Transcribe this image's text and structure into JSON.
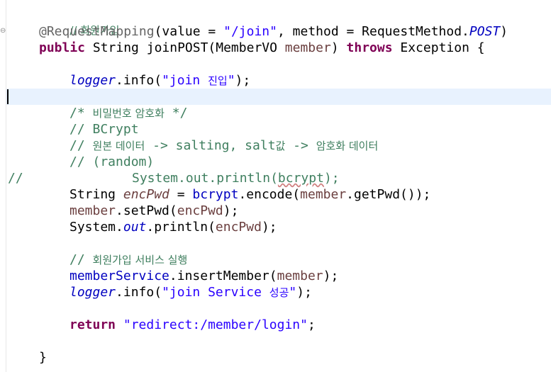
{
  "editor": {
    "fold_marker": "⊖",
    "lines": {
      "l1": {
        "comment": "// 회원가입"
      },
      "l2": {
        "annotation": "@RequestMapping",
        "p1": "(value = ",
        "str": "\"/join\"",
        "p2": ", method = RequestMethod.",
        "const": "POST",
        "p3": ")"
      },
      "l3": {
        "kw1": "public",
        "p1": " String joinPOST(MemberVO ",
        "param": "member",
        "p2": ") ",
        "kw2": "throws",
        "p3": " Exception {"
      },
      "l4": {
        "field": "logger",
        "p1": ".info(",
        "str_a": "\"join ",
        "str_b": "진입",
        "str_c": "\"",
        "p2": ");"
      },
      "l5": {
        "comment_a": "/* ",
        "comment_b": "비밀번호 암호화",
        "comment_c": " */"
      },
      "l6": {
        "comment": "// BCrypt"
      },
      "l7": {
        "comment_a": "// ",
        "comment_b": "원본 데이터",
        "comment_c": " -> salting, salt",
        "comment_d": "값",
        "comment_e": " -> ",
        "comment_f": "암호화 데이터"
      },
      "l8": {
        "comment": "// (random)"
      },
      "l9": {
        "prefix": "//",
        "code_a": "System.out.println(",
        "code_b": "bcrypt",
        "code_c": ");"
      },
      "l10": {
        "p1": "String ",
        "local": "encPwd",
        "p2": " = ",
        "field": "bcrypt",
        "p3": ".encode(",
        "param": "member",
        "p4": ".getPwd());"
      },
      "l11": {
        "param": "member",
        "p1": ".setPwd(",
        "local": "encPwd",
        "p2": ");"
      },
      "l12": {
        "p1": "System.",
        "static": "out",
        "p2": ".println(",
        "local": "encPwd",
        "p3": ");"
      },
      "l13": {
        "comment_a": "// ",
        "comment_b": "회원가입 서비스 실행"
      },
      "l14": {
        "field": "memberService",
        "p1": ".insertMember(",
        "param": "member",
        "p2": ");"
      },
      "l15": {
        "field": "logger",
        "p1": ".info(",
        "str_a": "\"join Service ",
        "str_b": "성공",
        "str_c": "\"",
        "p2": ");"
      },
      "l16": {
        "kw": "return",
        "p1": " ",
        "str": "\"redirect:/member/login\"",
        "p2": ";"
      },
      "l17": {
        "brace": "}"
      }
    }
  }
}
